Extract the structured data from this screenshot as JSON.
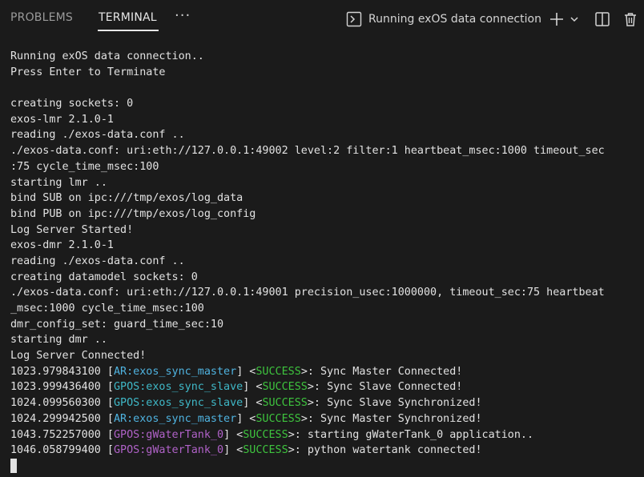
{
  "tabs": {
    "problems": "PROBLEMS",
    "terminal": "TERMINAL",
    "more": "···"
  },
  "terminal_select": {
    "name": "Running exOS data connection"
  },
  "icons": [
    "terminal-icon",
    "plus-icon",
    "chevron-down-icon",
    "split-icon",
    "trash-icon"
  ],
  "colors": {
    "background": "#1b1b1b",
    "text": "#e2e2e2",
    "ar_tag": "#4fb3e0",
    "gpos_tag": "#3fb8c7",
    "gpos_var": "#b062c8",
    "success": "#3ec43e"
  },
  "output": {
    "plain_lines": [
      "Running exOS data connection..",
      "Press Enter to Terminate",
      "",
      "creating sockets: 0",
      "exos-lmr 2.1.0-1",
      "reading ./exos-data.conf ..",
      "./exos-data.conf: uri:eth://127.0.0.1:49002 level:2 filter:1 heartbeat_msec:1000 timeout_sec",
      ":75 cycle_time_msec:100",
      "starting lmr ..",
      "bind SUB on ipc:///tmp/exos/log_data",
      "bind PUB on ipc:///tmp/exos/log_config",
      "Log Server Started!",
      "exos-dmr 2.1.0-1",
      "reading ./exos-data.conf ..",
      "creating datamodel sockets: 0",
      "./exos-data.conf: uri:eth://127.0.0.1:49001 precision_usec:1000000, timeout_sec:75 heartbeat",
      "_msec:1000 cycle_time_msec:100",
      "dmr_config_set: guard_time_sec:10",
      "starting dmr ..",
      "Log Server Connected!"
    ],
    "log_lines": [
      {
        "time": "1023.979843100",
        "source": "AR:exos_sync_master",
        "kind": "ar",
        "level": "SUCCESS",
        "message": "Sync Master Connected!"
      },
      {
        "time": "1023.999436400",
        "source": "GPOS:exos_sync_slave",
        "kind": "gpos",
        "level": "SUCCESS",
        "message": "Sync Slave Connected!"
      },
      {
        "time": "1024.099560300",
        "source": "GPOS:exos_sync_slave",
        "kind": "gpos",
        "level": "SUCCESS",
        "message": "Sync Slave Synchronized!"
      },
      {
        "time": "1024.299942500",
        "source": "AR:exos_sync_master",
        "kind": "ar",
        "level": "SUCCESS",
        "message": "Sync Master Synchronized!"
      },
      {
        "time": "1043.752257000",
        "source": "GPOS:gWaterTank_0",
        "kind": "gpos-var",
        "level": "SUCCESS",
        "message": "starting gWaterTank_0 application.."
      },
      {
        "time": "1046.058799400",
        "source": "GPOS:gWaterTank_0",
        "kind": "gpos-var",
        "level": "SUCCESS",
        "message": "python watertank connected!"
      }
    ]
  }
}
